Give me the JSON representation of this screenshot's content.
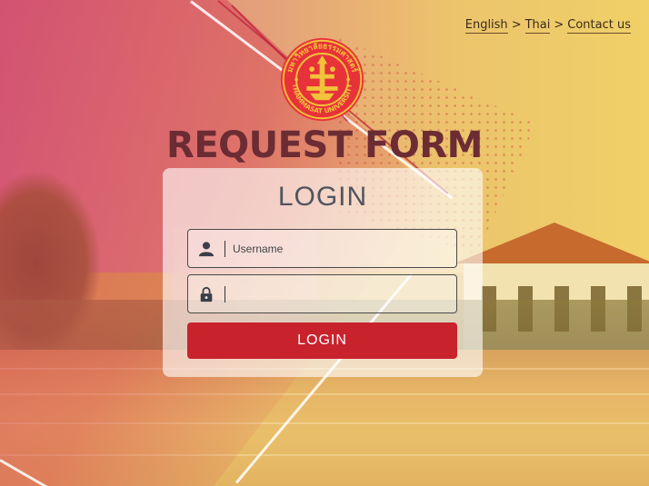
{
  "nav": {
    "english": "English",
    "sep1": ">",
    "thai": "Thai",
    "sep2": ">",
    "contact": "Contact us"
  },
  "logo": {
    "top_text": "มหาวิทยาลัยธรรมศาสตร์",
    "bottom_text": "THAMMASAT UNIVERSITY",
    "color": "#e8323a"
  },
  "page_title": "REQUEST FORM",
  "login": {
    "heading": "LOGIN",
    "username_placeholder": "Username",
    "password_placeholder": "",
    "button_label": "LOGIN"
  },
  "colors": {
    "title": "#6b2c34",
    "button": "#c8222d",
    "heading": "#4f5560"
  },
  "icons": {
    "username": "user-icon",
    "password": "lock-icon"
  }
}
